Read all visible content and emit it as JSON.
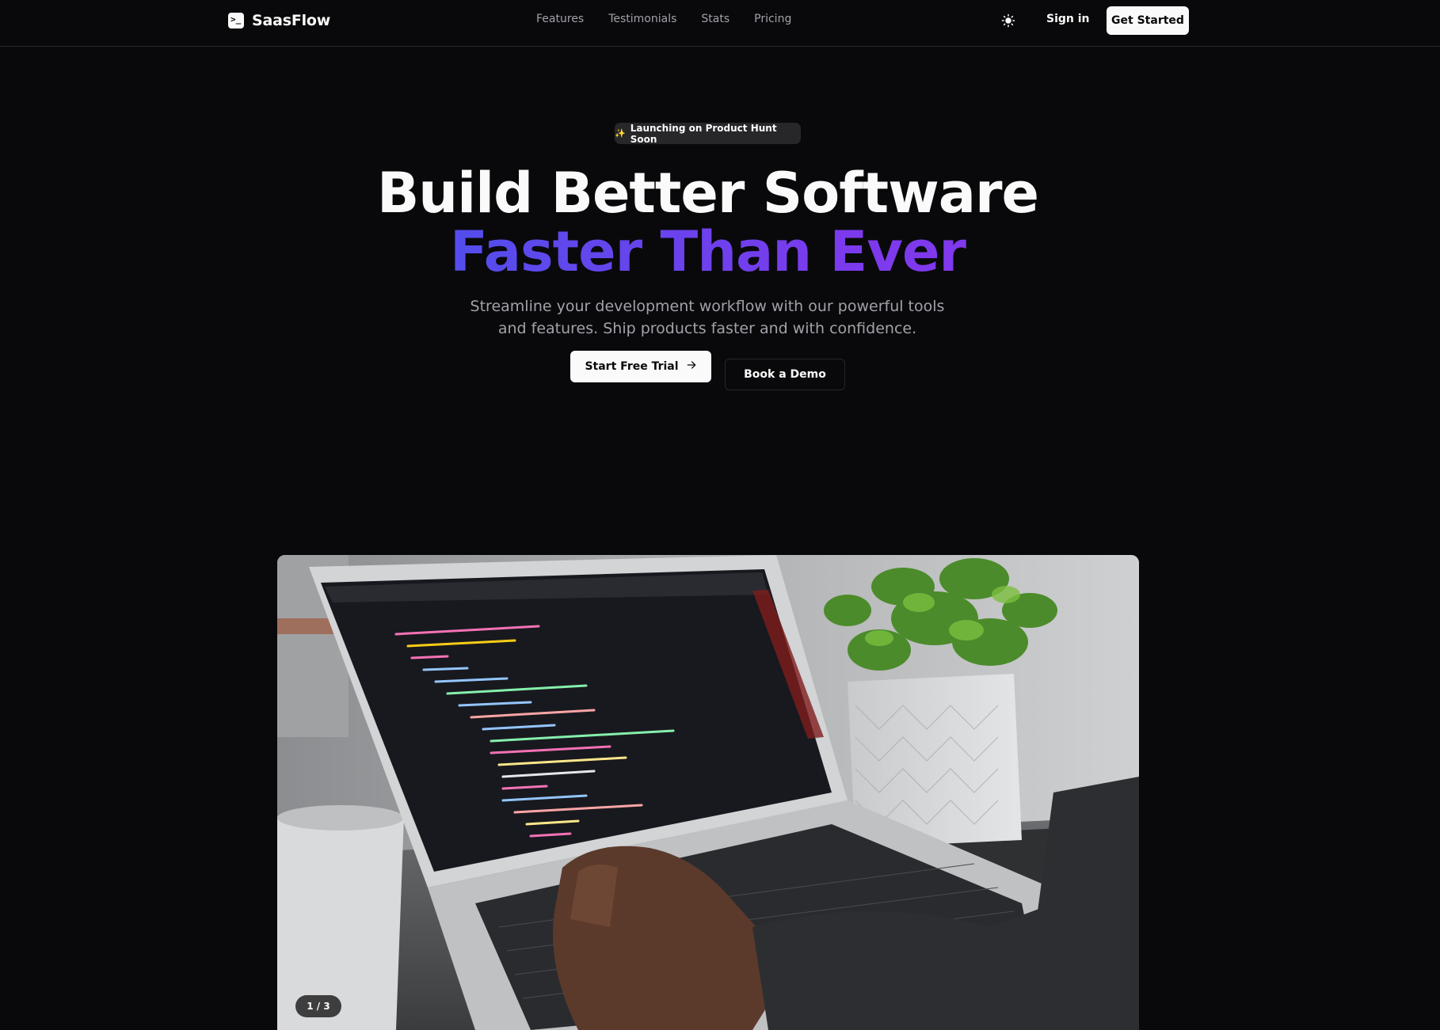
{
  "brand": {
    "name": "SaasFlow",
    "icon": "terminal-icon"
  },
  "nav": {
    "links": [
      "Features",
      "Testimonials",
      "Stats",
      "Pricing"
    ],
    "theme_icon": "sun-icon",
    "sign_in": "Sign in",
    "get_started": "Get Started"
  },
  "hero": {
    "badge_icon": "sparkles-icon",
    "badge": "Launching on Product Hunt Soon",
    "title_line1": "Build Better Software",
    "title_line2": "Faster Than Ever",
    "subtitle": "Streamline your development workflow with our powerful tools and features. Ship products faster and with confidence.",
    "primary_cta": "Start Free Trial",
    "primary_cta_icon": "arrow-right-icon",
    "secondary_cta": "Book a Demo"
  },
  "carousel": {
    "counter": "1 / 3"
  },
  "colors": {
    "background": "#09090b",
    "border": "#27272a",
    "text": "#fafafa",
    "muted": "#a1a1aa",
    "gradient_start": "#2563eb",
    "gradient_end": "#9333ea"
  }
}
